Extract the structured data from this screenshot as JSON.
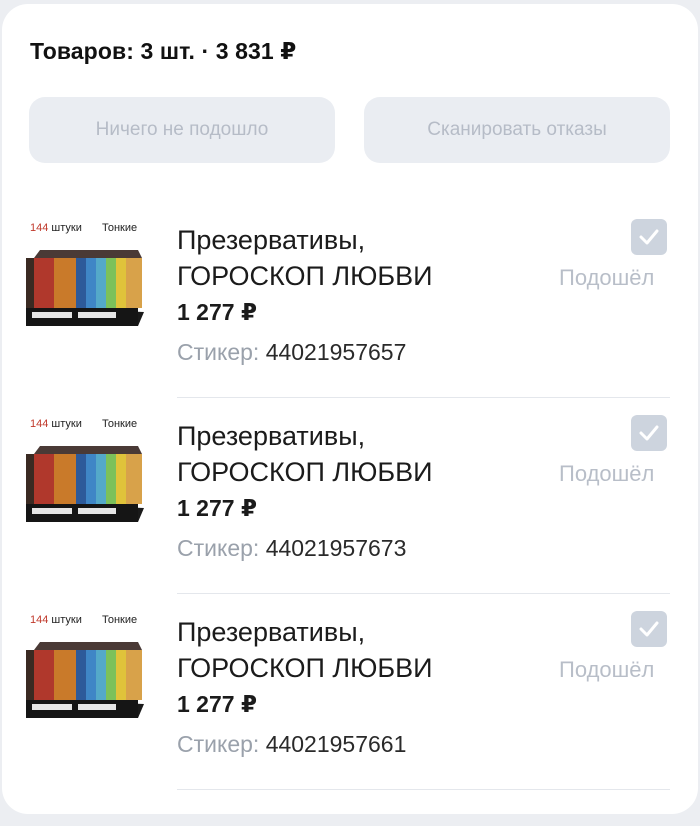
{
  "summary": "Товаров: 3 шт. · 3 831 ₽",
  "buttons": {
    "none_fit": "Ничего не подошло",
    "scan_refusals": "Сканировать отказы"
  },
  "items": [
    {
      "thumb_qty": "144",
      "thumb_qty_unit": "штуки",
      "thumb_type": "Тонкие",
      "title_line1": "Презервативы,",
      "title_line2": "ГОРОСКОП ЛЮБВИ",
      "price": "1 277 ₽",
      "sticker_label": "Стикер:",
      "sticker_number": "44021957657",
      "status": "Подошёл",
      "checked": true
    },
    {
      "thumb_qty": "144",
      "thumb_qty_unit": "штуки",
      "thumb_type": "Тонкие",
      "title_line1": "Презервативы,",
      "title_line2": "ГОРОСКОП ЛЮБВИ",
      "price": "1 277 ₽",
      "sticker_label": "Стикер:",
      "sticker_number": "44021957673",
      "status": "Подошёл",
      "checked": true
    },
    {
      "thumb_qty": "144",
      "thumb_qty_unit": "штуки",
      "thumb_type": "Тонкие",
      "title_line1": "Презервативы,",
      "title_line2": "ГОРОСКОП ЛЮБВИ",
      "price": "1 277 ₽",
      "sticker_label": "Стикер:",
      "sticker_number": "44021957661",
      "status": "Подошёл",
      "checked": true
    }
  ],
  "colors": {
    "background": "#eceef2",
    "card": "#ffffff",
    "button_bg": "#eaedf2",
    "button_text": "#b6bcc7",
    "checkbox": "#cdd4de",
    "status_text": "#b8bec8",
    "qty_red": "#c0392b"
  }
}
